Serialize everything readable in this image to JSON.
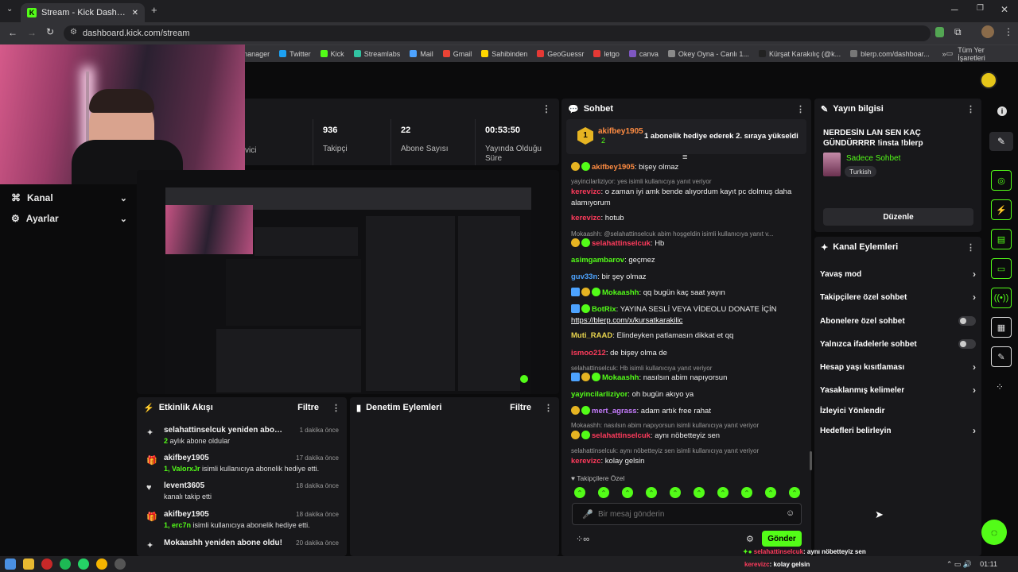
{
  "browser": {
    "tab_title": "Stream - Kick Dashboard",
    "url": "dashboard.kick.com/stream",
    "bookmarks": [
      "ss manager",
      "Twitter",
      "Kick",
      "Streamlabs",
      "Mail",
      "Gmail",
      "Sahibinden",
      "GeoGuessr",
      "letgo",
      "canva",
      "Okey Oyna - Canlı 1...",
      "Kürşat Karakılıç (@k...",
      "blerp.com/dashboar..."
    ],
    "all_bookmarks": "Tüm Yer İşaretleri"
  },
  "stats": [
    {
      "value": "",
      "label": "vici"
    },
    {
      "value": "936",
      "label": "Takipçi"
    },
    {
      "value": "22",
      "label": "Abone Sayısı"
    },
    {
      "value": "00:53:50",
      "label": "Yayında Olduğu Süre"
    }
  ],
  "nav": {
    "kanal": "Kanal",
    "ayarlar": "Ayarlar"
  },
  "activity": {
    "title": "Etkinlik Akışı",
    "filter": "Filtre",
    "events": [
      {
        "title": "selahattinselcuk yeniden abone oldu!",
        "time": "1 dakika önce",
        "sub_strong": "2",
        "sub": " aylık abone oldular"
      },
      {
        "title": "akifbey1905",
        "time": "17 dakika önce",
        "sub_strong": "1, ValorxJr",
        "sub": " isimli kullanıcıya abonelik hediye etti."
      },
      {
        "title": "levent3605",
        "time": "18 dakika önce",
        "sub_strong": "",
        "sub": "kanalı takip etti"
      },
      {
        "title": "akifbey1905",
        "time": "18 dakika önce",
        "sub_strong": "1, erc7n",
        "sub": " isimli kullanıcıya abonelik hediye etti."
      },
      {
        "title": "Mokaashh yeniden abone oldu!",
        "time": "20 dakika önce",
        "sub_strong": "",
        "sub": ""
      }
    ]
  },
  "moderation": {
    "title": "Denetim Eylemleri",
    "filter": "Filtre"
  },
  "chat": {
    "title": "Sohbet",
    "pinned_user": "akifbey1905",
    "pinned_count": "2",
    "pinned_text": "1 abonelik hediye ederek 2. sıraya yükseldi",
    "messages": [
      {
        "user": "akifbey1905",
        "color": "#ff8c42",
        "text": ": bişey olmaz"
      },
      {
        "reply": "yayincilarliziyor: yes isimli kullanıcıya yanıt veriyor"
      },
      {
        "user": "kerevizc",
        "color": "#ff3b5c",
        "text": ": o zaman iyi amk bende alıyordum kayıt pc dolmuş daha alamıyorum"
      },
      {
        "user": "kerevizc",
        "color": "#ff3b5c",
        "text": ": hotub"
      },
      {
        "reply": "Mokaashh: @selahattinselcuk abim hoşgeldin isimli kullanıcıya yanıt v..."
      },
      {
        "user": "selahattinselcuk",
        "color": "#ff3b5c",
        "text": ": Hb"
      },
      {
        "user": "asimgambarov",
        "color": "#53fc18",
        "text": ": geçmez"
      },
      {
        "user": "guv33n",
        "color": "#4da3ff",
        "text": ": bir şey olmaz"
      },
      {
        "user": "Mokaashh",
        "color": "#53fc18",
        "text": ": qq bugün kaç saat yayın"
      },
      {
        "user": "BotRix",
        "color": "#53fc18",
        "text": ": YAYINA SESLİ VEYA VİDEOLU DONATE İÇİN"
      },
      {
        "link": "https://blerp.com/x/kursatkarakilic"
      },
      {
        "user": "Muti_RAAD",
        "color": "#e8d44d",
        "text": ": Elindeyken patlamasın dikkat et qq"
      },
      {
        "user": "ismoo212",
        "color": "#ff3b5c",
        "text": ": de bişey olma de"
      },
      {
        "reply": "selahattinselcuk: Hb isimli kullanıcıya yanıt veriyor"
      },
      {
        "user": "Mokaashh",
        "color": "#53fc18",
        "text": ": nasılsın abim napıyorsun"
      },
      {
        "user": "yayincilarliziyor",
        "color": "#53fc18",
        "text": ": oh bugün akıyo ya"
      },
      {
        "user": "mert_agrass",
        "color": "#c77dff",
        "text": ": adam artık free rahat"
      },
      {
        "reply": "Mokaashh: nasılsın abim napıyorsun isimli kullanıcıya yanıt veriyor"
      },
      {
        "user": "selahattinselcuk",
        "color": "#ff3b5c",
        "text": ": aynı nöbetteyiz sen"
      },
      {
        "reply": "selahattinselcuk: aynı nöbetteyiz sen isimli kullanıcıya yanıt veriyor"
      },
      {
        "user": "kerevizc",
        "color": "#ff3b5c",
        "text": ": kolay gelsin"
      }
    ],
    "followers_only": "Takipçilere Özel",
    "input_placeholder": "Bir mesaj gönderin",
    "send": "Gönder"
  },
  "stream_info": {
    "title": "Yayın bilgisi",
    "stream_title": "NERDESİN LAN SEN KAÇ GÜNDÜRRRR !insta !blerp",
    "category": "Sadece Sohbet",
    "language": "Turkish",
    "edit": "Düzenle"
  },
  "channel_actions": {
    "title": "Kanal Eylemleri",
    "items": [
      "Yavaş mod",
      "Takipçilere özel sohbet",
      "Abonelere özel sohbet",
      "Yalnızca ifadelerle sohbet",
      "Hesap yaşı kısıtlaması",
      "Yasaklanmış kelimeler",
      "İzleyici Yönlendir",
      "Hedefleri belirleyin"
    ]
  },
  "overlay": {
    "l1u": "selahattinselcuk",
    "l1": ": aynı nöbetteyiz sen",
    "l2u": "kerevizc",
    "l2": ": kolay gelsin"
  },
  "taskbar": {
    "time": "01:11"
  },
  "colors": {
    "accent": "#53fc18",
    "panel": "#18181b",
    "bg": "#0b0b0c"
  }
}
